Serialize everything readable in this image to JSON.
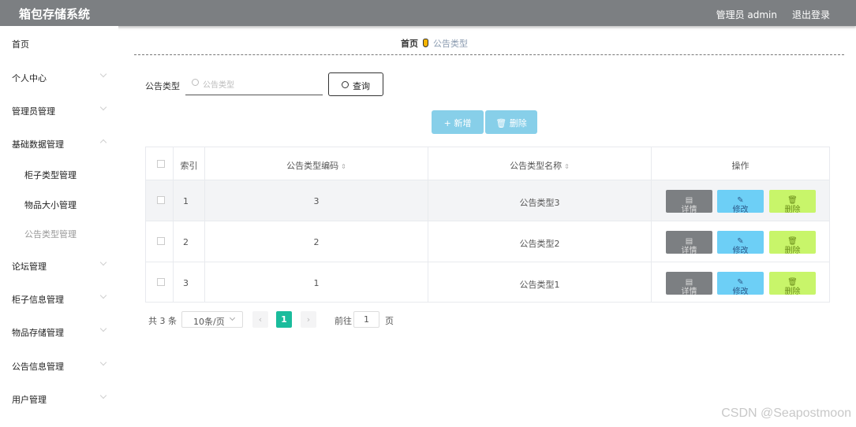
{
  "header": {
    "title": "箱包存储系统",
    "admin": "管理员 admin",
    "logout": "退出登录"
  },
  "sidebar": {
    "items": [
      {
        "label": "首页"
      },
      {
        "label": "个人中心"
      },
      {
        "label": "管理员管理"
      },
      {
        "label": "基础数据管理"
      },
      {
        "label": "柜子类型管理"
      },
      {
        "label": "物品大小管理"
      },
      {
        "label": "公告类型管理"
      },
      {
        "label": "论坛管理"
      },
      {
        "label": "柜子信息管理"
      },
      {
        "label": "物品存储管理"
      },
      {
        "label": "公告信息管理"
      },
      {
        "label": "用户管理"
      }
    ]
  },
  "breadcrumb": {
    "home": "首页",
    "current": "公告类型"
  },
  "search": {
    "label": "公告类型",
    "placeholder": "公告类型",
    "button": "查询"
  },
  "actions": {
    "add": "+ 新增",
    "delete": "删除"
  },
  "table": {
    "columns": [
      "索引",
      "公告类型编码",
      "公告类型名称",
      "操作"
    ],
    "rows": [
      {
        "index": "1",
        "code": "3",
        "name": "公告类型3"
      },
      {
        "index": "2",
        "code": "2",
        "name": "公告类型2"
      },
      {
        "index": "3",
        "code": "1",
        "name": "公告类型1"
      }
    ],
    "row_actions": {
      "detail": "详情",
      "edit": "修改",
      "delete": "删除"
    }
  },
  "pagination": {
    "total": "共 3 条",
    "page_size": "10条/页",
    "current": "1",
    "goto_label": "前往",
    "goto_value": "1",
    "goto_suffix": "页"
  },
  "watermark": "CSDN @Seapostmoon",
  "colors": {
    "header": "#7c7f82",
    "accent_blue": "#87cfe9",
    "edit": "#6dcff6",
    "delete": "#c8f56a",
    "pager_active": "#1abc9c"
  }
}
